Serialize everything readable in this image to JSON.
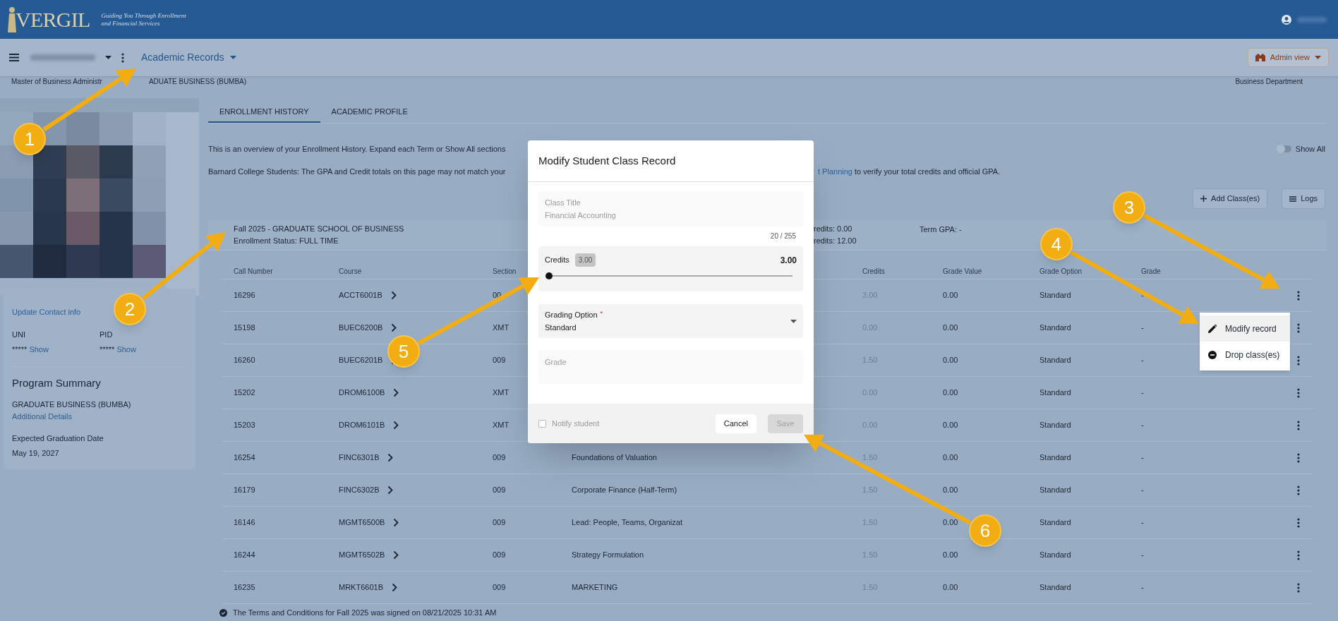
{
  "header": {
    "logo": "VERGIL",
    "tagline_lines": [
      "Guiding You Through Enrollment",
      "and Financial Services"
    ]
  },
  "nav": {
    "title": "Academic Records",
    "admin_button": "Admin view"
  },
  "program_bar": {
    "left_parts": [
      "Master of Business Administr",
      "ADUATE BUSINESS (BUMBA)"
    ],
    "right": "Business Department"
  },
  "profile": {
    "contact_link": "Update Contact info",
    "ids": [
      {
        "label": "UNI",
        "masked": "*****",
        "action": "Show"
      },
      {
        "label": "PID",
        "masked": "*****",
        "action": "Show"
      }
    ],
    "summary_title": "Program Summary",
    "program": "GRADUATE BUSINESS (BUMBA)",
    "details_link": "Additional Details",
    "graduation_label": "Expected Graduation Date",
    "graduation_date": "May 19, 2027"
  },
  "tabs": [
    {
      "label": "ENROLLMENT HISTORY",
      "selected": true
    },
    {
      "label": "ACADEMIC PROFILE",
      "selected": false
    }
  ],
  "intro": "This is an overview of your Enrollment History. Expand each Term or Show All sections",
  "show_all": {
    "label": "Show All",
    "on": false
  },
  "notice": {
    "left": "Barnard College Students: The GPA and Credit totals on this page may not match your",
    "link": "t Planning",
    "right": "to verify your total credits and official GPA."
  },
  "actions": [
    {
      "label": "Add Class(es)",
      "kind": "add"
    },
    {
      "label": "Logs",
      "kind": "list"
    }
  ],
  "term": {
    "title": "Fall 2025 - GRADUATE SCHOOL OF BUSINESS",
    "status": "Enrollment Status: FULL TIME",
    "credits_lines": [
      "redits: 0.00",
      "redits: 12.00"
    ],
    "gpa": "Term GPA: -"
  },
  "table": {
    "columns": [
      "Call Number",
      "Course",
      "Section",
      "Credits",
      "Grade Value",
      "Grade Option",
      "Grade"
    ],
    "rows": [
      {
        "call": "16296",
        "course": "ACCT6001B",
        "section": "00",
        "credits": "3.00",
        "grade_value": "0.00",
        "grade_option": "Standard",
        "grade": "-"
      },
      {
        "call": "15198",
        "course": "BUEC6200B",
        "section": "XMT",
        "credits": "0.00",
        "grade_value": "0.00",
        "grade_option": "Standard",
        "grade": "-"
      },
      {
        "call": "16260",
        "course": "BUEC6201B",
        "section": "009",
        "credits": "1.50",
        "grade_value": "0.00",
        "grade_option": "Standard",
        "grade": "-"
      },
      {
        "call": "15202",
        "course": "DROM6100B",
        "section": "XMT",
        "credits": "0.00",
        "grade_value": "0.00",
        "grade_option": "Standard",
        "grade": "-"
      },
      {
        "call": "15203",
        "course": "DROM6101B",
        "section": "XMT",
        "credits": "0.00",
        "grade_value": "0.00",
        "grade_option": "Standard",
        "grade": "-"
      },
      {
        "call": "16254",
        "course": "FINC6301B",
        "section": "009",
        "title": "Foundations of Valuation",
        "credits": "1.50",
        "grade_value": "0.00",
        "grade_option": "Standard",
        "grade": "-"
      },
      {
        "call": "16179",
        "course": "FINC6302B",
        "section": "009",
        "title": "Corporate Finance (Half-Term)",
        "credits": "1.50",
        "grade_value": "0.00",
        "grade_option": "Standard",
        "grade": "-"
      },
      {
        "call": "16146",
        "course": "MGMT6500B",
        "section": "009",
        "title": "Lead: People, Teams, Organizat",
        "credits": "1.50",
        "grade_value": "0.00",
        "grade_option": "Standard",
        "grade": "-"
      },
      {
        "call": "16244",
        "course": "MGMT6502B",
        "section": "009",
        "title": "Strategy Formulation",
        "credits": "1.50",
        "grade_value": "0.00",
        "grade_option": "Standard",
        "grade": "-"
      },
      {
        "call": "16235",
        "course": "MRKT6601B",
        "section": "009",
        "title": "MARKETING",
        "credits": "1.50",
        "grade_value": "0.00",
        "grade_option": "Standard",
        "grade": "-"
      }
    ]
  },
  "footer_note": "The Terms and Conditions for Fall 2025 was signed on 08/21/2025 10:31 AM",
  "modal": {
    "title": "Modify Student Class Record",
    "class_title": {
      "label": "Class Title",
      "value": "Financial Accounting",
      "counter": "20 / 255",
      "disabled": true
    },
    "credits": {
      "label": "Credits",
      "badge": "3.00",
      "value": "3.00",
      "level": 0
    },
    "grading": {
      "label": "Grading Option",
      "required_mark": "*",
      "value": "Standard"
    },
    "grade": {
      "label": "Grade"
    },
    "notify": {
      "label": "Notify student",
      "checked": false,
      "disabled": true
    },
    "cancel": "Cancel",
    "save": {
      "label": "Save",
      "disabled": true
    }
  },
  "menu": [
    {
      "label": "Modify record",
      "kind": "edit",
      "selected": true
    },
    {
      "label": "Drop class(es)",
      "kind": "drop",
      "selected": false
    }
  ],
  "annotations": [
    {
      "label": "1"
    },
    {
      "label": "2"
    },
    {
      "label": "3"
    },
    {
      "label": "4"
    },
    {
      "label": "5"
    },
    {
      "label": "6"
    }
  ]
}
